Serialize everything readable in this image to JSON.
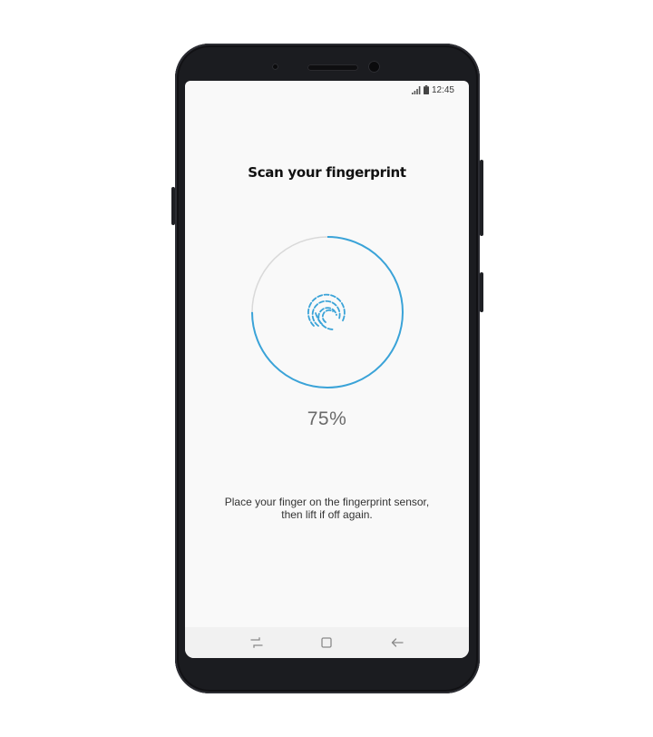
{
  "status_bar": {
    "time": "12:45",
    "icons": [
      "signal-icon",
      "battery-icon"
    ]
  },
  "screen": {
    "title": "Scan your fingerprint",
    "progress_percent": 75,
    "progress_label": "75%",
    "instruction_line1": "Place your finger on the fingerprint sensor,",
    "instruction_line2": "then lift if off again."
  },
  "nav_bar": {
    "buttons": [
      "recent-apps-icon",
      "home-icon",
      "back-icon"
    ]
  },
  "colors": {
    "accent": "#3aa3d8",
    "ring_track": "#d9d9d9",
    "phone_body": "#1b1c20"
  }
}
